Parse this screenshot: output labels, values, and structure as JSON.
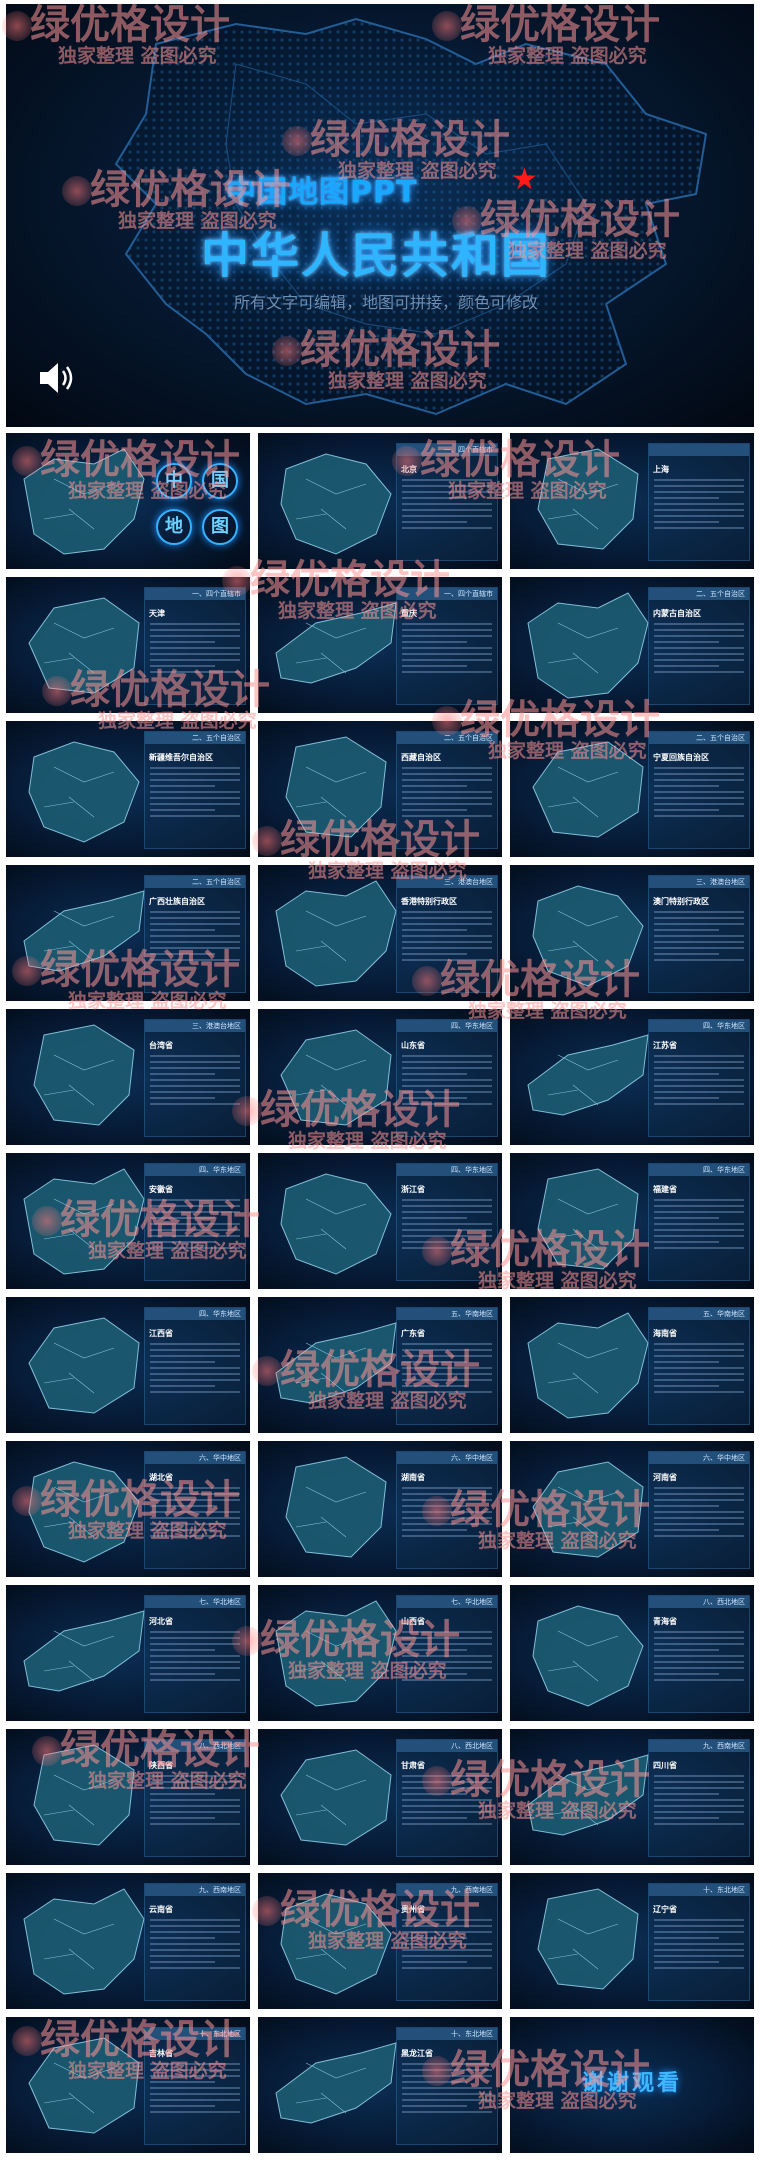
{
  "hero": {
    "subtitle": "中国地图PPT",
    "star": "★",
    "title": "中华人民共和国",
    "caption": "所有文字可编辑，地图可拼接，颜色可修改",
    "speaker_icon": "speaker-icon"
  },
  "watermark": {
    "line1": "绿优格设计",
    "line2": "独家整理 盗图必究"
  },
  "colors": {
    "background": "#061a33",
    "accent": "#1aa7ff",
    "star": "#ff1a1a",
    "panel_header": "#23507a"
  },
  "slides": [
    {
      "kind": "cover",
      "chars": [
        "中",
        "国",
        "地",
        "图"
      ]
    },
    {
      "kind": "region",
      "header": "一、四个直辖市",
      "name": "北京"
    },
    {
      "kind": "region",
      "header": "",
      "name": "上海"
    },
    {
      "kind": "region",
      "header": "一、四个直辖市",
      "name": "天津"
    },
    {
      "kind": "region",
      "header": "一、四个直辖市",
      "name": "重庆"
    },
    {
      "kind": "region",
      "header": "二、五个自治区",
      "name": "内蒙古自治区"
    },
    {
      "kind": "region",
      "header": "二、五个自治区",
      "name": "新疆维吾尔自治区"
    },
    {
      "kind": "region",
      "header": "二、五个自治区",
      "name": "西藏自治区"
    },
    {
      "kind": "region",
      "header": "二、五个自治区",
      "name": "宁夏回族自治区"
    },
    {
      "kind": "region",
      "header": "二、五个自治区",
      "name": "广西壮族自治区"
    },
    {
      "kind": "region",
      "header": "三、港澳台地区",
      "name": "香港特别行政区"
    },
    {
      "kind": "region",
      "header": "三、港澳台地区",
      "name": "澳门特别行政区"
    },
    {
      "kind": "region",
      "header": "三、港澳台地区",
      "name": "台湾省"
    },
    {
      "kind": "region",
      "header": "四、华东地区",
      "name": "山东省"
    },
    {
      "kind": "region",
      "header": "四、华东地区",
      "name": "江苏省"
    },
    {
      "kind": "region",
      "header": "四、华东地区",
      "name": "安徽省"
    },
    {
      "kind": "region",
      "header": "四、华东地区",
      "name": "浙江省"
    },
    {
      "kind": "region",
      "header": "四、华东地区",
      "name": "福建省"
    },
    {
      "kind": "region",
      "header": "四、华东地区",
      "name": "江西省"
    },
    {
      "kind": "region",
      "header": "五、华南地区",
      "name": "广东省"
    },
    {
      "kind": "region",
      "header": "五、华南地区",
      "name": "海南省"
    },
    {
      "kind": "region",
      "header": "六、华中地区",
      "name": "湖北省"
    },
    {
      "kind": "region",
      "header": "六、华中地区",
      "name": "湖南省"
    },
    {
      "kind": "region",
      "header": "六、华中地区",
      "name": "河南省"
    },
    {
      "kind": "region",
      "header": "七、华北地区",
      "name": "河北省"
    },
    {
      "kind": "region",
      "header": "七、华北地区",
      "name": "山西省"
    },
    {
      "kind": "region",
      "header": "八、西北地区",
      "name": "青海省"
    },
    {
      "kind": "region",
      "header": "八、西北地区",
      "name": "陕西省"
    },
    {
      "kind": "region",
      "header": "八、西北地区",
      "name": "甘肃省"
    },
    {
      "kind": "region",
      "header": "九、西南地区",
      "name": "四川省"
    },
    {
      "kind": "region",
      "header": "九、西南地区",
      "name": "云南省"
    },
    {
      "kind": "region",
      "header": "九、西南地区",
      "name": "贵州省"
    },
    {
      "kind": "region",
      "header": "十、东北地区",
      "name": "辽宁省"
    },
    {
      "kind": "region",
      "header": "十、东北地区",
      "name": "吉林省"
    },
    {
      "kind": "region",
      "header": "十、东北地区",
      "name": "黑龙江省"
    },
    {
      "kind": "thanks",
      "text": "谢谢观看"
    }
  ]
}
